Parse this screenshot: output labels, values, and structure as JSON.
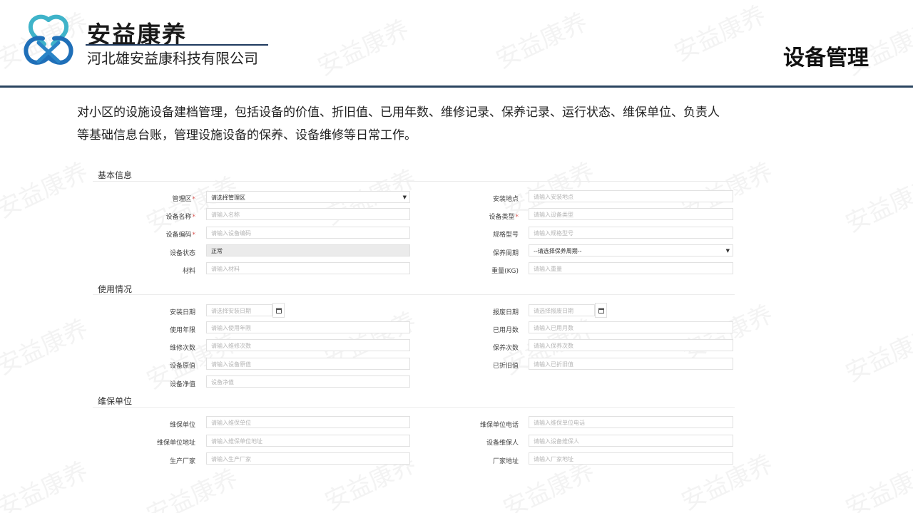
{
  "brand": {
    "name": "安益康养",
    "company": "河北雄安益康科技有限公司"
  },
  "page_title": "设备管理",
  "description": [
    "对小区的设施设备建档管理，包括设备的价值、折旧值、已用年数、维修记录、保养记录、运行状态、维保单位、负责人",
    "等基础信息台账，管理设施设备的保养、设备维修等日常工作。"
  ],
  "watermark": "安益康养",
  "colors": {
    "accent": "#2a4560",
    "required": "#d9534f"
  },
  "sections": {
    "basic": {
      "title": "基本信息"
    },
    "usage": {
      "title": "使用情况"
    },
    "maintenance": {
      "title": "维保单位"
    }
  },
  "basic": {
    "management_area": {
      "label": "管理区",
      "value": "请选择管理区"
    },
    "install_location": {
      "label": "安装地点",
      "placeholder": "请输入安装地点"
    },
    "device_name": {
      "label": "设备名称",
      "placeholder": "请输入名称"
    },
    "device_type": {
      "label": "设备类型",
      "placeholder": "请输入设备类型"
    },
    "device_code": {
      "label": "设备编码",
      "placeholder": "请输入设备编码"
    },
    "spec_model": {
      "label": "规格型号",
      "placeholder": "请输入规格型号"
    },
    "device_status": {
      "label": "设备状态",
      "value": "正常"
    },
    "maintain_cycle": {
      "label": "保养周期",
      "value": "--请选择保养周期--"
    },
    "material": {
      "label": "材料",
      "placeholder": "请输入材料"
    },
    "weight": {
      "label": "重量(KG)",
      "placeholder": "请输入重量"
    }
  },
  "usage": {
    "install_date": {
      "label": "安装日期",
      "placeholder": "请选择安装日期"
    },
    "scrap_date": {
      "label": "报废日期",
      "placeholder": "请选择报废日期"
    },
    "service_years": {
      "label": "使用年限",
      "placeholder": "请输入使用年限"
    },
    "used_months": {
      "label": "已用月数",
      "placeholder": "请输入已用月数"
    },
    "repair_count": {
      "label": "维修次数",
      "placeholder": "请输入维修次数"
    },
    "maintain_count": {
      "label": "保养次数",
      "placeholder": "请输入保养次数"
    },
    "original_value": {
      "label": "设备原值",
      "placeholder": "请输入设备原值"
    },
    "depreciated": {
      "label": "已折旧值",
      "placeholder": "请输入已折旧值"
    },
    "net_value": {
      "label": "设备净值",
      "placeholder": "设备净值"
    }
  },
  "maintenance": {
    "unit": {
      "label": "维保单位",
      "placeholder": "请输入维保单位"
    },
    "unit_phone": {
      "label": "维保单位电话",
      "placeholder": "请输入维保单位电话"
    },
    "unit_address": {
      "label": "维保单位地址",
      "placeholder": "请输入维保单位地址"
    },
    "keeper": {
      "label": "设备维保人",
      "placeholder": "请输入设备维保人"
    },
    "manufacturer": {
      "label": "生产厂家",
      "placeholder": "请输入生产厂家"
    },
    "factory_address": {
      "label": "厂家地址",
      "placeholder": "请输入厂家地址"
    }
  }
}
